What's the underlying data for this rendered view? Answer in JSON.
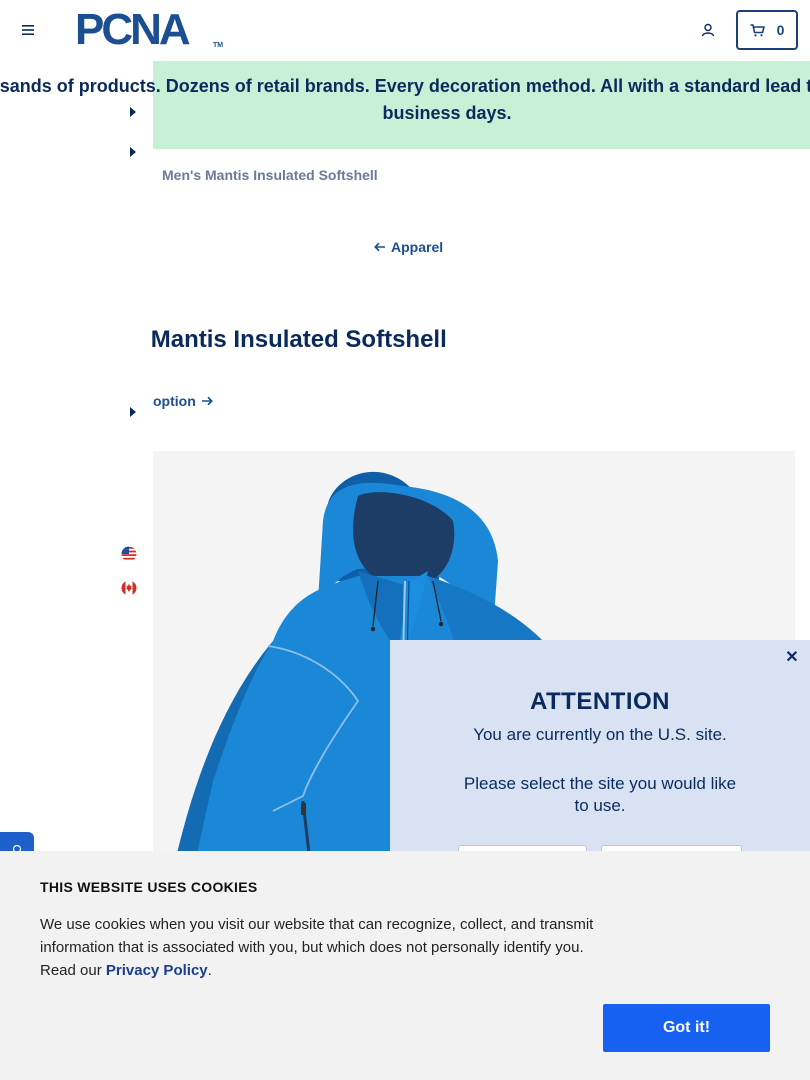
{
  "header": {
    "logo_text": "PCNA",
    "logo_tm": "TM",
    "cart_count": "0"
  },
  "promo": {
    "text": "Thousands of products. Dozens of retail brands. Every decoration method. All with a standard lead time of just five business days."
  },
  "breadcrumb": {
    "current": "Men's Mantis Insulated Softshell"
  },
  "back_link": {
    "label": "Apparel"
  },
  "product": {
    "title": "Men's Mantis Insulated Softshell",
    "option_label": "option",
    "image_alt": "Blue insulated softshell jacket with hood",
    "jacket_color": "#1a88d6"
  },
  "country_selector": {
    "us_flag": "us-flag-icon",
    "ca_flag": "canada-flag-icon"
  },
  "modal": {
    "title": "ATTENTION",
    "message": "You are currently on the U.S. site.",
    "prompt": "Please select the site you would like to use."
  },
  "cookie": {
    "title": "THIS WEBSITE USES COOKIES",
    "body": "We use cookies when you visit our website that can recognize, collect, and transmit information that is associated with you, but which does not personally identify you. Read our",
    "link": "Privacy Policy",
    "period": ".",
    "button": "Got it!"
  },
  "colors": {
    "brand": "#1b4f91",
    "navy": "#0b2a5c",
    "promo_bg": "#c8f0d7",
    "modal_bg": "#d8e2f3",
    "cookie_button": "#1660f2",
    "feedback_tab": "#1f5fc9"
  }
}
